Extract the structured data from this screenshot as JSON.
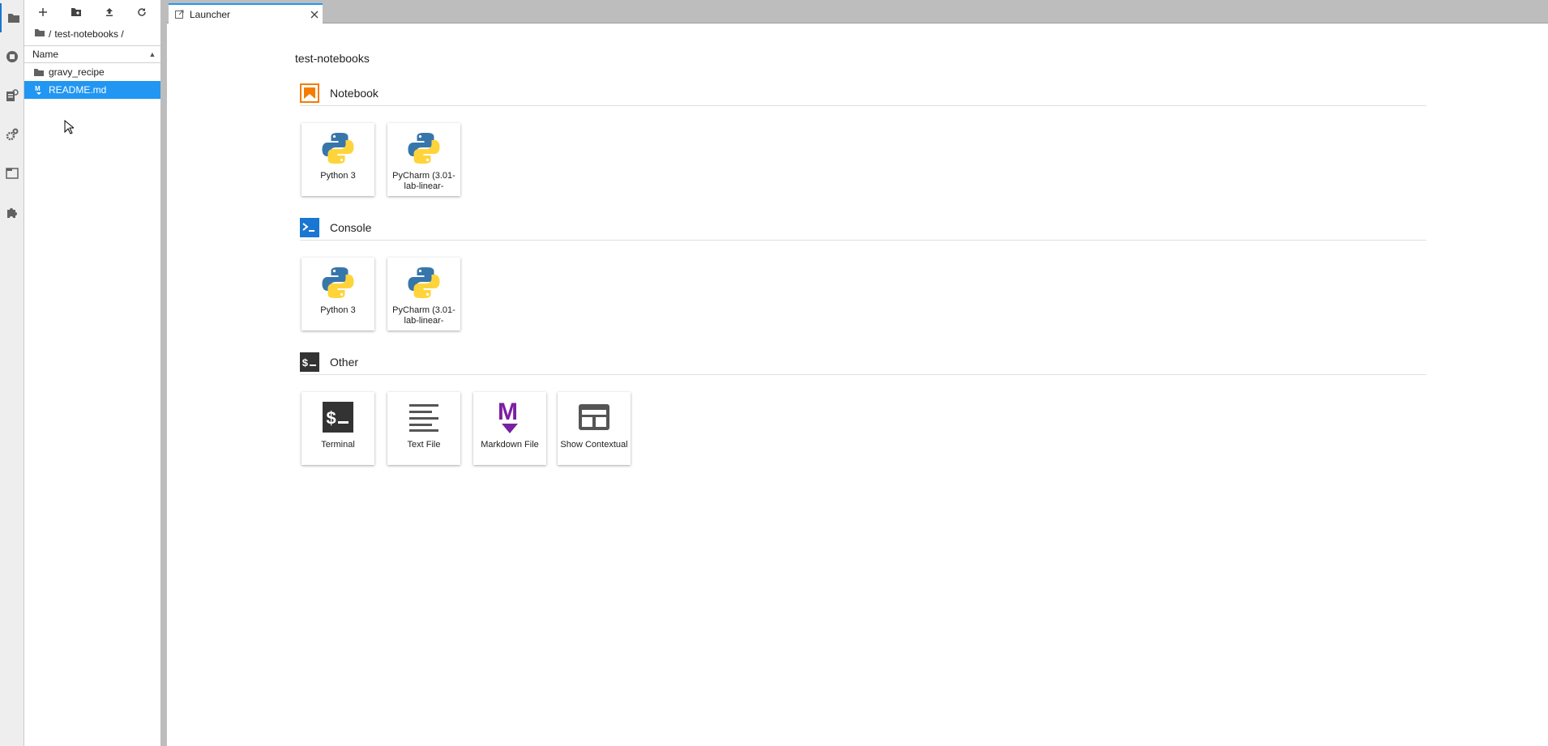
{
  "filebrowser": {
    "breadcrumb": {
      "separator": "/",
      "folder": "test-notebooks /"
    },
    "header": {
      "name_label": "Name"
    },
    "items": [
      {
        "name": "gravy_recipe",
        "icon": "folder-icon",
        "selected": false
      },
      {
        "name": "README.md",
        "icon": "markdown-icon",
        "selected": true
      }
    ]
  },
  "tab": {
    "label": "Launcher",
    "icon": "launcher-icon"
  },
  "launcher": {
    "cwd": "test-notebooks",
    "sections": {
      "notebook": {
        "title": "Notebook",
        "cards": [
          {
            "label": "Python 3"
          },
          {
            "label": "PyCharm (3.01-lab-linear-"
          }
        ]
      },
      "console": {
        "title": "Console",
        "cards": [
          {
            "label": "Python 3"
          },
          {
            "label": "PyCharm (3.01-lab-linear-"
          }
        ]
      },
      "other": {
        "title": "Other",
        "cards": [
          {
            "label": "Terminal"
          },
          {
            "label": "Text File"
          },
          {
            "label": "Markdown File"
          },
          {
            "label": "Show Contextual"
          }
        ]
      }
    }
  },
  "colors": {
    "accent": "#2196f3",
    "notebook": "#f57c00",
    "console": "#1976d2",
    "markdown": "#7b1fa2",
    "dark_icon": "#333333"
  }
}
